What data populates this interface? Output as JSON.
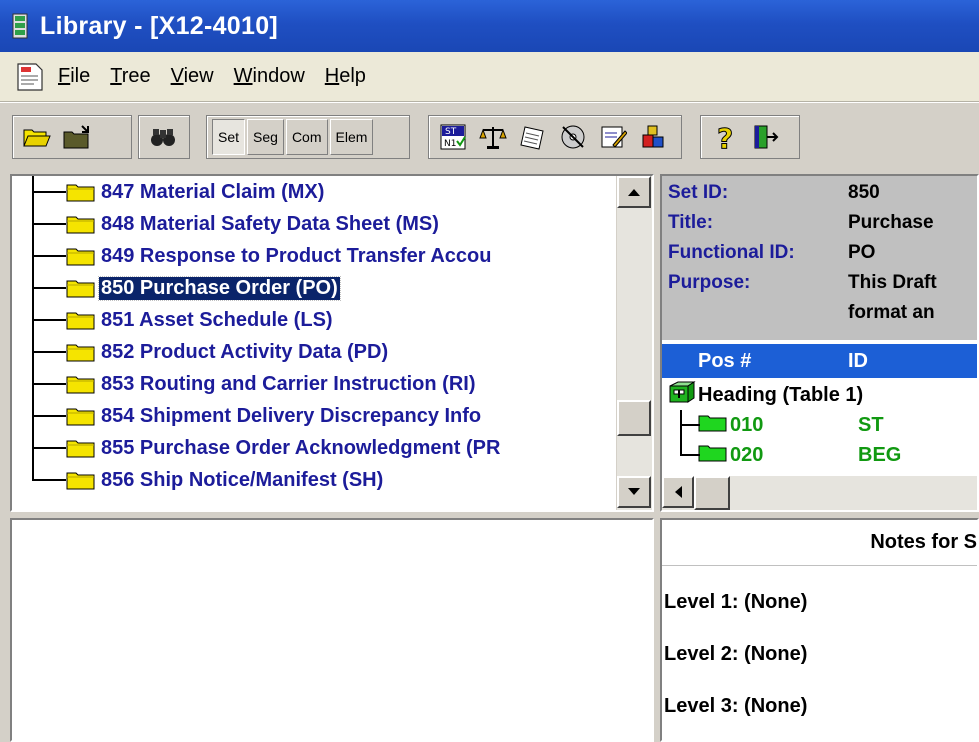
{
  "window": {
    "title": "Library - [X12-4010]"
  },
  "menu": [
    {
      "underline": "F",
      "rest": "ile"
    },
    {
      "underline": "T",
      "rest": "ree"
    },
    {
      "underline": "V",
      "rest": "iew"
    },
    {
      "underline": "W",
      "rest": "indow"
    },
    {
      "underline": "H",
      "rest": "elp"
    }
  ],
  "toolbar": {
    "view_buttons": [
      "Set",
      "Seg",
      "Com",
      "Elem"
    ]
  },
  "tree": {
    "items": [
      "847 Material Claim (MX)",
      "848 Material Safety Data Sheet (MS)",
      "849 Response to Product Transfer Accou",
      "850 Purchase Order (PO)",
      "851 Asset Schedule (LS)",
      "852 Product Activity Data (PD)",
      "853 Routing and Carrier Instruction (RI)",
      "854 Shipment Delivery Discrepancy Info",
      "855 Purchase Order Acknowledgment (PR",
      "856 Ship Notice/Manifest (SH)"
    ],
    "selected_index": 3
  },
  "set_info": {
    "set_id_label": "Set ID:",
    "set_id": "850",
    "title_label": "Title:",
    "title": "Purchase",
    "functional_id_label": "Functional ID:",
    "functional_id": "PO",
    "purpose_label": "Purpose:",
    "purpose_line1": "This Draft",
    "purpose_line2": "format an"
  },
  "segments": {
    "col_pos": "Pos #",
    "col_id": "ID",
    "heading": "Heading (Table 1)",
    "rows": [
      {
        "pos": "010",
        "id": "ST"
      },
      {
        "pos": "020",
        "id": "BEG"
      }
    ]
  },
  "notes": {
    "title": "Notes for S",
    "level1": "Level 1:  (None)",
    "level2": "Level 2:  (None)",
    "level3": "Level 3:  (None)"
  },
  "colors": {
    "titlebar": "#1f4fc2",
    "selected": "#0a246a",
    "tree_text": "#1c1c9a",
    "segment_text": "#119911",
    "folder": "#f5e400"
  }
}
